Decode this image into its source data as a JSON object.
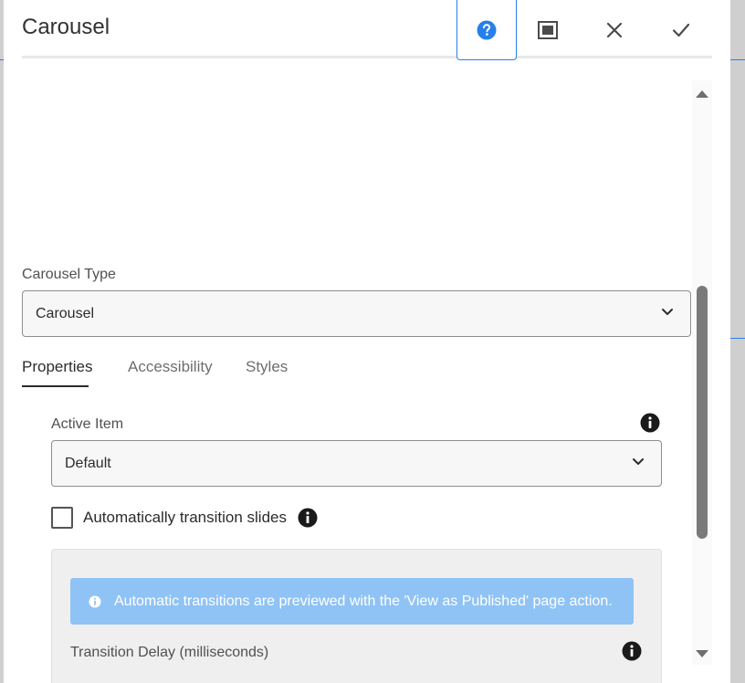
{
  "dialog": {
    "title": "Carousel",
    "header_buttons": [
      "help",
      "fullscreen",
      "close",
      "done"
    ]
  },
  "carousel_type": {
    "label": "Carousel Type",
    "value": "Carousel"
  },
  "tabs": [
    {
      "label": "Properties",
      "active": true
    },
    {
      "label": "Accessibility",
      "active": false
    },
    {
      "label": "Styles",
      "active": false
    }
  ],
  "active_item": {
    "label": "Active Item",
    "value": "Default"
  },
  "auto_transition": {
    "label": "Automatically transition slides",
    "checked": false
  },
  "transition_panel": {
    "alert_text": "Automatic transitions are previewed with the 'View as Published' page action.",
    "delay_label": "Transition Delay (milliseconds)"
  },
  "colors": {
    "accent": "#2680eb",
    "alert_bg": "#8fc3f5"
  }
}
